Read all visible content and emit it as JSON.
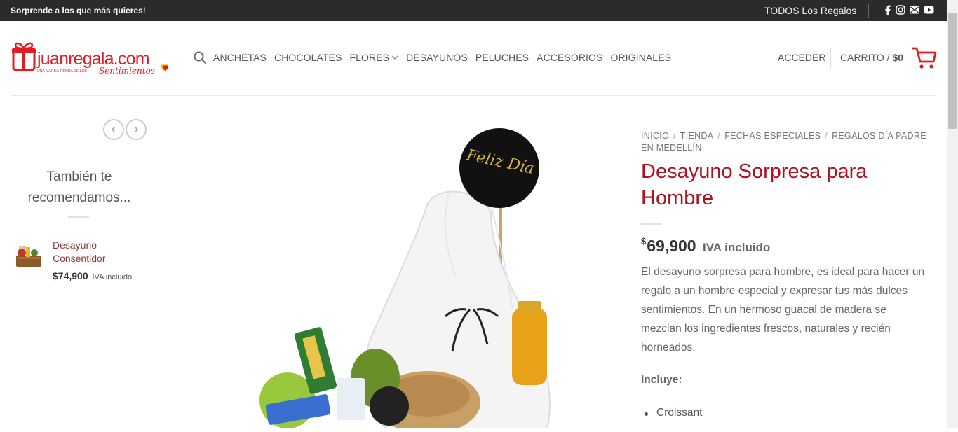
{
  "topbar": {
    "promo": "Sorprende a los que más quieres!",
    "all_gifts": "TODOS Los Regalos",
    "social": [
      "facebook-icon",
      "instagram-icon",
      "email-icon",
      "youtube-icon"
    ]
  },
  "brand": {
    "name": "juanregala.com",
    "tagline_small": "UNA MARCA TIENDA DE LOS",
    "tagline_script": "Sentimientos",
    "accent": "#e31b23"
  },
  "nav": {
    "items": [
      "ANCHETAS",
      "CHOCOLATES",
      "FLORES",
      "DESAYUNOS",
      "PELUCHES",
      "ACCESORIOS",
      "ORIGINALES"
    ]
  },
  "header": {
    "account": "ACCEDER",
    "cart_label": "CARRITO",
    "cart_sep": "/",
    "cart_total": "$0"
  },
  "sidebar": {
    "title": "También te recomendamos...",
    "product": {
      "name": "Desayuno Consentidor",
      "price": "$74,900",
      "tax": "IVA incluido"
    }
  },
  "product": {
    "breadcrumb": [
      "INICIO",
      "TIENDA",
      "FECHAS ESPECIALES",
      "REGALOS DÍA PADRE EN MEDELLÍN"
    ],
    "title": "Desayuno Sorpresa para Hombre",
    "currency": "$",
    "price": "69,900",
    "tax": "IVA incluido",
    "description": "El desayuno sorpresa para hombre, es ideal para hacer un regalo a un hombre especial y expresar tus más dulces sentimientos. En un hermoso guacal de madera se mezclan los ingredientes frescos, naturales y recién horneados.",
    "includes_label": "Incluye:",
    "includes": [
      "Croissant"
    ],
    "image_text": "Feliz Día",
    "title_color": "#b01020"
  }
}
